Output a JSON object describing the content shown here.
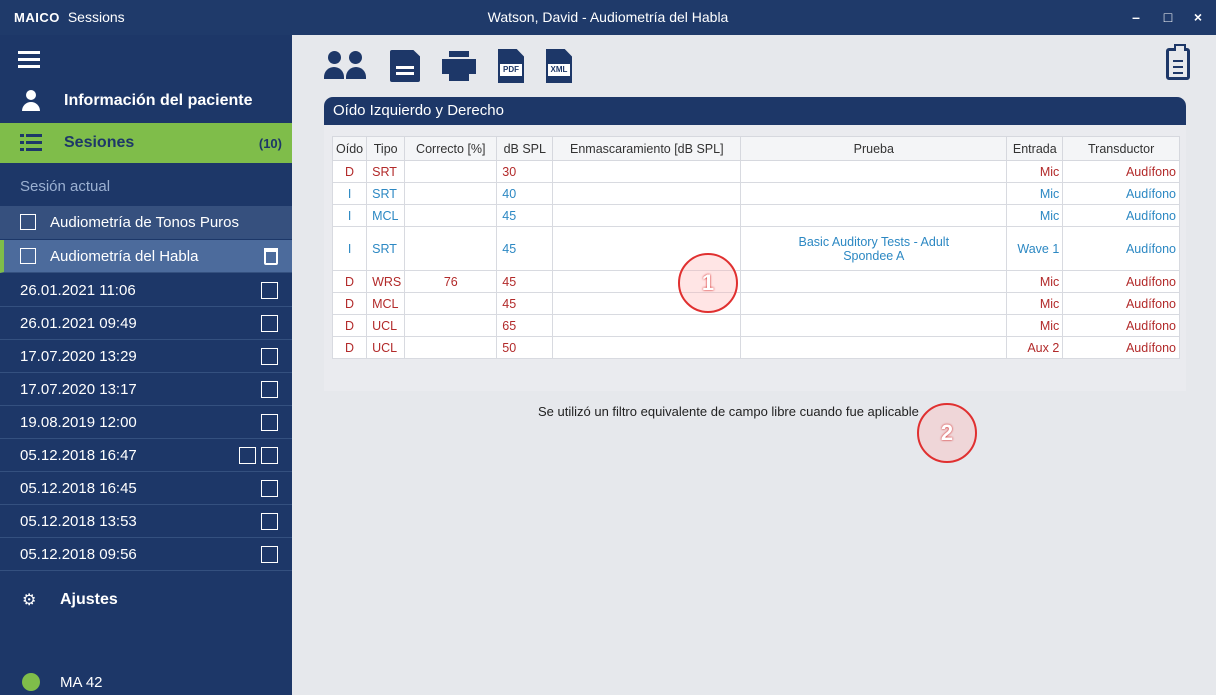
{
  "titlebar": {
    "logo": "MAICO",
    "app": "Sessions",
    "title": "Watson, David - Audiometría del Habla",
    "minimize": "–",
    "maximize": "□",
    "close": "×"
  },
  "sidebar": {
    "patient_info": "Información del paciente",
    "sessions": "Sesiones",
    "sessions_count": "(10)",
    "current_session": "Sesión actual",
    "tests": [
      {
        "label": "Audiometría de Tonos Puros"
      },
      {
        "label": "Audiometría del Habla"
      }
    ],
    "history": [
      {
        "date": "26.01.2021 11:06",
        "icons": [
          "pure-tone"
        ]
      },
      {
        "date": "26.01.2021 09:49",
        "icons": [
          "pure-tone"
        ]
      },
      {
        "date": "17.07.2020 13:29",
        "icons": [
          "speech"
        ]
      },
      {
        "date": "17.07.2020 13:17",
        "icons": [
          "bars"
        ]
      },
      {
        "date": "19.08.2019 12:00",
        "icons": [
          "speech"
        ]
      },
      {
        "date": "05.12.2018 16:47",
        "icons": [
          "speech",
          "pure-tone"
        ]
      },
      {
        "date": "05.12.2018 16:45",
        "icons": [
          "speech"
        ]
      },
      {
        "date": "05.12.2018 13:53",
        "icons": [
          "pure-tone"
        ]
      },
      {
        "date": "05.12.2018 09:56",
        "icons": [
          "pure-tone"
        ]
      }
    ],
    "settings": "Ajustes",
    "device": "MA 42"
  },
  "toolbar": {
    "pdf_label": "PDF",
    "xml_label": "XML"
  },
  "panel": {
    "title": "Oído Izquierdo y Derecho",
    "columns": [
      "Oído",
      "Tipo",
      "Correcto [%]",
      "dB SPL",
      "Enmascaramiento [dB SPL]",
      "Prueba",
      "Entrada",
      "Transductor"
    ],
    "rows": [
      {
        "ear": "D",
        "type": "SRT",
        "correct": "",
        "db": "30",
        "mask": "",
        "test": "",
        "input": "Mic",
        "transducer": "Audífono"
      },
      {
        "ear": "I",
        "type": "SRT",
        "correct": "",
        "db": "40",
        "mask": "",
        "test": "",
        "input": "Mic",
        "transducer": "Audífono"
      },
      {
        "ear": "I",
        "type": "MCL",
        "correct": "",
        "db": "45",
        "mask": "",
        "test": "",
        "input": "Mic",
        "transducer": "Audífono"
      },
      {
        "ear": "I",
        "type": "SRT",
        "correct": "",
        "db": "45",
        "mask": "",
        "test": "Basic Auditory Tests - Adult Spondee A",
        "input": "Wave 1",
        "transducer": "Audífono"
      },
      {
        "ear": "D",
        "type": "WRS",
        "correct": "76",
        "db": "45",
        "mask": "",
        "test": "",
        "input": "Mic",
        "transducer": "Audífono"
      },
      {
        "ear": "D",
        "type": "MCL",
        "correct": "",
        "db": "45",
        "mask": "",
        "test": "",
        "input": "Mic",
        "transducer": "Audífono"
      },
      {
        "ear": "D",
        "type": "UCL",
        "correct": "",
        "db": "65",
        "mask": "",
        "test": "",
        "input": "Mic",
        "transducer": "Audífono"
      },
      {
        "ear": "D",
        "type": "UCL",
        "correct": "",
        "db": "50",
        "mask": "",
        "test": "",
        "input": "Aux 2",
        "transducer": "Audífono"
      }
    ],
    "note": "Se utilizó un filtro equivalente de campo libre cuando fue aplicable"
  },
  "markers": [
    "1",
    "2"
  ],
  "colors": {
    "nav": "#1d3768",
    "accent": "#7fbd4a",
    "right_ear": "#b22a2a",
    "left_ear": "#2c88c3"
  }
}
